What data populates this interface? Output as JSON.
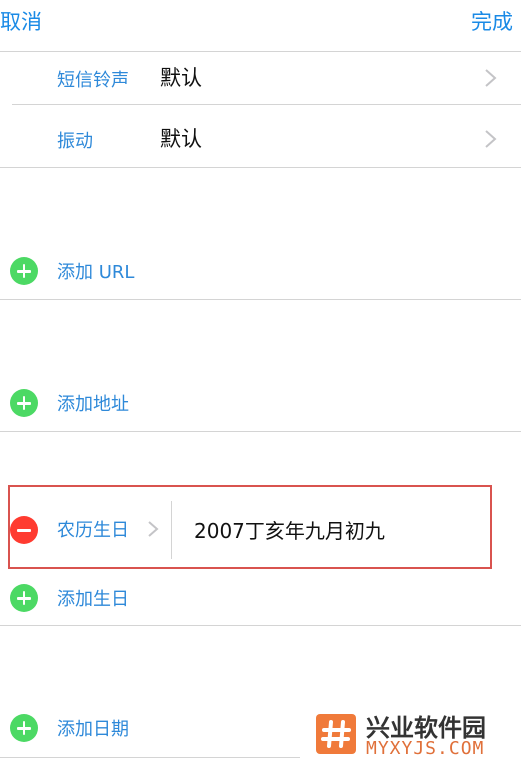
{
  "nav": {
    "cancel_label": "取消",
    "done_label": "完成"
  },
  "settings": [
    {
      "label": "短信铃声",
      "value": "默认"
    },
    {
      "label": "振动",
      "value": "默认"
    }
  ],
  "add_rows": {
    "url": "添加 URL",
    "address": "添加地址",
    "birthday": "添加生日",
    "date": "添加日期"
  },
  "lunar_birthday": {
    "label": "农历生日",
    "value": "2007丁亥年九月初九"
  },
  "watermark": {
    "title": "兴业软件园",
    "url": "MYXYJS.COM"
  },
  "colors": {
    "accent": "#1a8ae6",
    "add_icon": "#4cd964",
    "remove_icon": "#ff3b30",
    "highlight_border": "#d9534f"
  }
}
